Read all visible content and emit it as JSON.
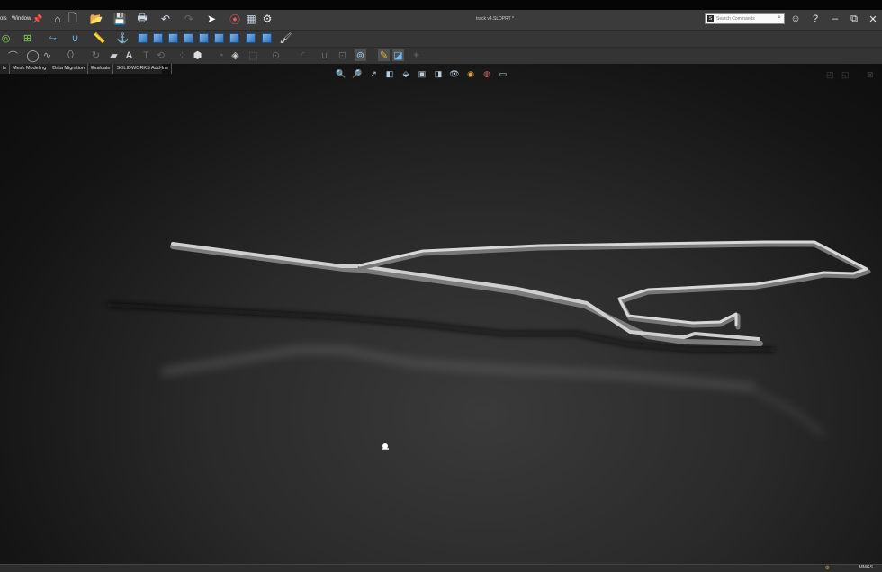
{
  "menu": {
    "items": [
      "ols",
      "Window"
    ]
  },
  "document": {
    "title": "track v4.SLDPRT *"
  },
  "search": {
    "placeholder": "Search Commands"
  },
  "tabs": [
    {
      "label": "ls"
    },
    {
      "label": "Mesh Modeling"
    },
    {
      "label": "Data Migration"
    },
    {
      "label": "Evaluate"
    },
    {
      "label": "SOLIDWORKS Add-Ins"
    }
  ],
  "statusbar": {
    "units": "MMGS"
  },
  "icons": {
    "pin": "pin-icon",
    "home": "home-icon",
    "new": "new-document-icon",
    "open": "open-folder-icon",
    "save": "save-icon",
    "print": "print-icon",
    "undo": "undo-icon",
    "redo": "redo-icon",
    "select": "select-pointer-icon",
    "rebuild": "traffic-light-icon",
    "options": "gear-icon"
  },
  "colors": {
    "accent": "#2f6fb4",
    "background": "#1e1e1e",
    "toolbar": "#363636"
  }
}
